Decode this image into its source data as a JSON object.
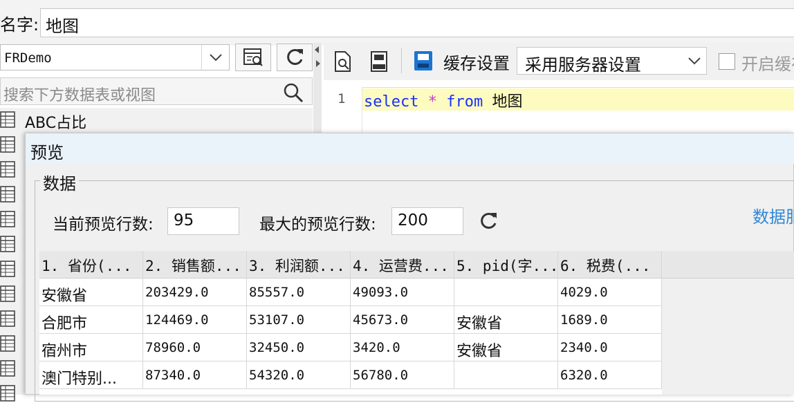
{
  "name_row": {
    "label": "名字:",
    "value": "地图"
  },
  "left_pane": {
    "datasource": "FRDemo",
    "search_placeholder": "搜索下方数据表或视图",
    "tables": [
      {
        "label": "ABC占比"
      }
    ]
  },
  "toolbar": {
    "cache_label": "缓存设置",
    "cache_select_value": "采用服务器设置",
    "cache_enable_label": "开启缓存"
  },
  "sql": {
    "line_number": "1",
    "kw_select": "select",
    "star": "*",
    "kw_from": "from",
    "table": "地图"
  },
  "preview": {
    "title": "预览",
    "group_label": "数据",
    "current_rows_label": "当前预览行数:",
    "current_rows_value": "95",
    "max_rows_label": "最大的预览行数:",
    "max_rows_value": "200",
    "data_link": "数据服"
  },
  "grid": {
    "columns": [
      "1. 省份(...",
      "2. 销售额...",
      "3. 利润额...",
      "4. 运营费...",
      "5. pid(字...",
      "6. 税费(..."
    ],
    "rows": [
      [
        "安徽省",
        "203429.0",
        "85557.0",
        "49093.0",
        "",
        "4029.0"
      ],
      [
        "合肥市",
        "124469.0",
        "53107.0",
        "45673.0",
        "安徽省",
        "1689.0"
      ],
      [
        "宿州市",
        "78960.0",
        "32450.0",
        "3420.0",
        "安徽省",
        "2340.0"
      ],
      [
        "澳门特别...",
        "87340.0",
        "54320.0",
        "56780.0",
        "",
        "6320.0"
      ]
    ]
  },
  "icons": {
    "chevron": "chevron-down-icon",
    "search": "search-icon",
    "refresh": "refresh-icon",
    "table": "table-icon"
  }
}
